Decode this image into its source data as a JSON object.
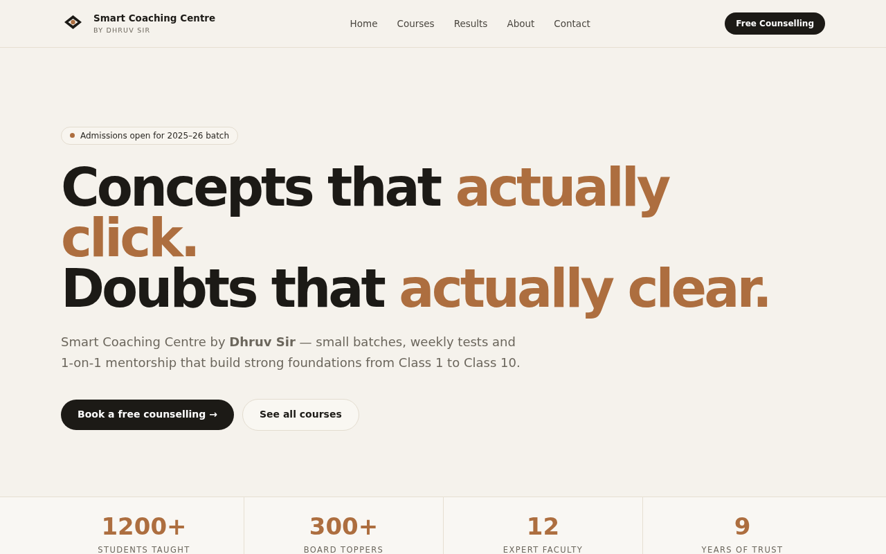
{
  "brand": {
    "name": "Smart Coaching Centre",
    "tagline": "BY DHRUV SIR"
  },
  "nav": [
    {
      "label": "Home"
    },
    {
      "label": "Courses"
    },
    {
      "label": "Results"
    },
    {
      "label": "About"
    },
    {
      "label": "Contact"
    }
  ],
  "header_button": "Free Counselling",
  "badge": "Admissions open for 2025–26 batch",
  "headline": [
    {
      "parts": [
        {
          "text": "Concepts that ",
          "accent": false
        },
        {
          "text": "actually click.",
          "accent": true
        }
      ]
    },
    {
      "parts": [
        {
          "text": "Doubts that ",
          "accent": false
        },
        {
          "text": "actually clear.",
          "accent": true
        }
      ]
    }
  ],
  "intro": "Smart Coaching Centre by **Dhruv Sir** — small batches, weekly tests and 1-on-1 mentorship that build strong foundations from Class 1 to Class 10.",
  "buttons": [
    {
      "label": "Book a free counselling →",
      "kind": "primary"
    },
    {
      "label": "See all courses",
      "kind": "secondary"
    }
  ],
  "stats": [
    {
      "value": "1200+",
      "label": "STUDENTS TAUGHT"
    },
    {
      "value": "300+",
      "label": "BOARD TOPPERS"
    },
    {
      "value": "12",
      "label": "EXPERT FACULTY"
    },
    {
      "value": "9",
      "label": "YEARS OF TRUST"
    }
  ]
}
